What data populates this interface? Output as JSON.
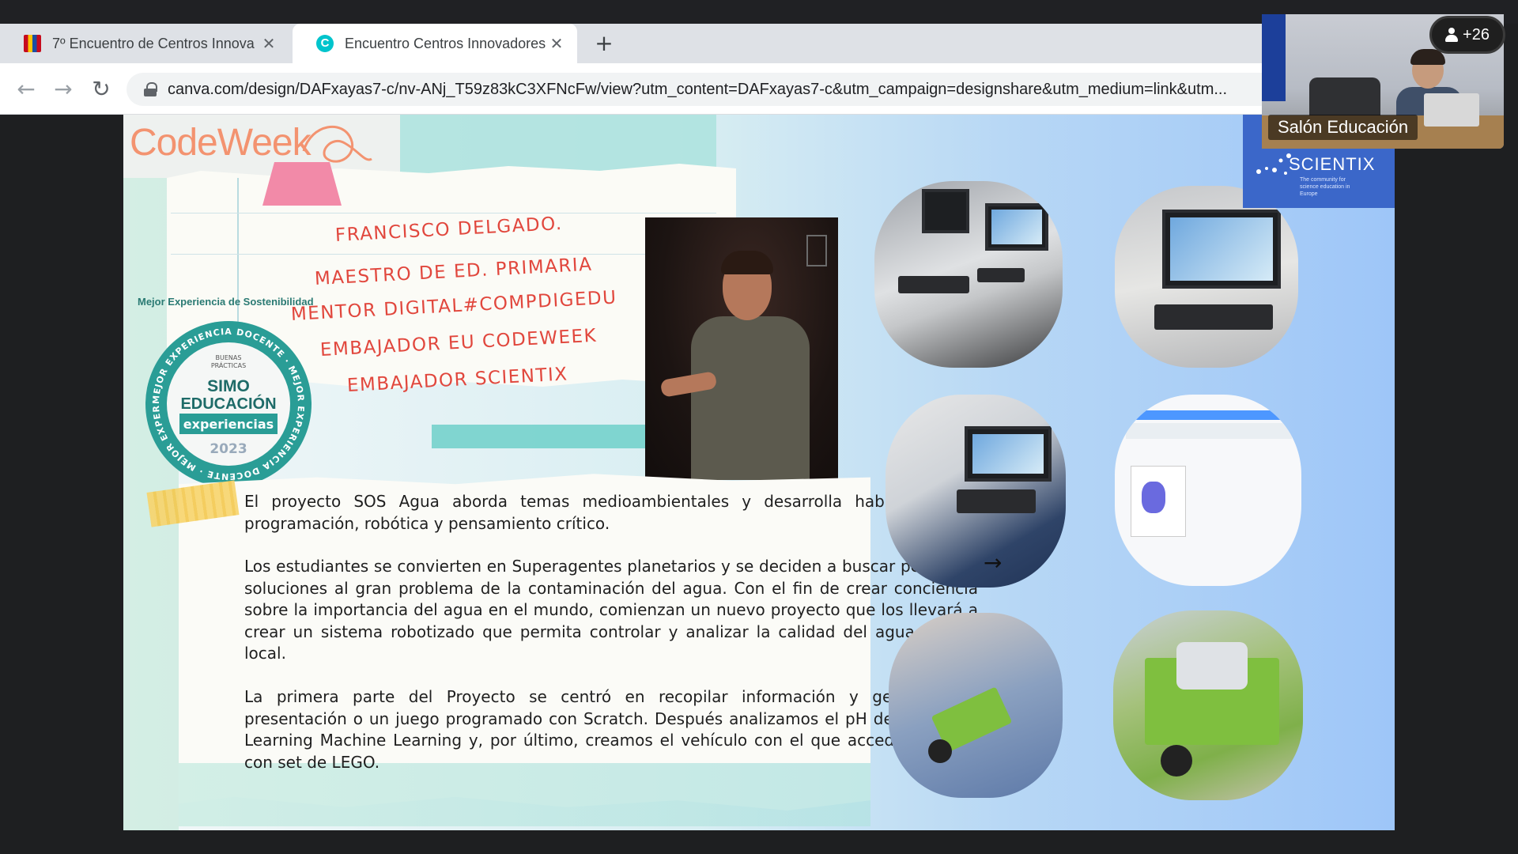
{
  "browser": {
    "tabs": [
      {
        "title": "7º Encuentro de Centros Innova",
        "close": "✕"
      },
      {
        "title": "Encuentro Centros Innovadores",
        "close": "✕"
      }
    ],
    "new_tab": "+",
    "url": "canva.com/design/DAFxayas7-c/nv-ANj_T59z83kC3XFNcFw/view?utm_content=DAFxayas7-c&utm_campaign=designshare&utm_medium=link&utm..."
  },
  "meeting": {
    "participants_badge": "+26",
    "camera_label": "Salón Educación"
  },
  "slide": {
    "logo": "CodeWeek",
    "bio_lines": [
      "FRANCISCO DELGADO.",
      "MAESTRO DE ED. PRIMARIA",
      "MENTOR DIGITAL#COMPDIGEDU",
      "EMBAJADOR EU CODEWEEK",
      "EMBAJADOR SCIENTIX"
    ],
    "award": {
      "title": "Mejor Experiencia de Sostenibilidad",
      "ring_text": "MEJOR EXPERIENCIA DOCENTE · MEJOR EXPERIENCIA DOCENTE · MEJOR EXPERIENCIA DOCENTE ·",
      "line1": "BUENAS",
      "line2": "PRÁCTICAS",
      "brand1": "SIMO",
      "brand2": "EDUCACIÓN",
      "ribbon": "experiencias",
      "year": "2023"
    },
    "paragraphs": [
      "El proyecto SOS Agua aborda temas medioambientales y desarrolla habilidades en programación, robótica y pensamiento crítico.",
      "Los estudiantes se convierten en Superagentes planetarios y se deciden a buscar pequeñas soluciones al gran problema de la contaminación del agua. Con el fin de crear conciencia sobre la importancia del agua en el mundo, comienzan un nuevo proyecto que los llevará a crear un sistema robotizado que permita controlar y analizar la calidad del agua a nivel local.",
      "La primera parte del Proyecto se centró en recopilar información y generar una presentación o un juego programado con Scratch. Después analizamos el pH del agua con Learning Machine Learning y, por último, creamos el vehículo con el que acceder al agua con set de LEGO."
    ],
    "scientix": {
      "name": "SCIENTIX",
      "tagline": "The community for science education in Europe"
    }
  },
  "colors": {
    "bio_red": "#e1473d",
    "codeweek_orange": "#f39370",
    "seal_teal": "#2a9d96",
    "scientix_blue": "#3b67c9"
  },
  "icons": [
    "back-arrow-icon",
    "forward-arrow-icon",
    "reload-icon",
    "lock-icon",
    "person-icon",
    "close-icon",
    "plus-icon",
    "cursor-arrow-icon"
  ]
}
